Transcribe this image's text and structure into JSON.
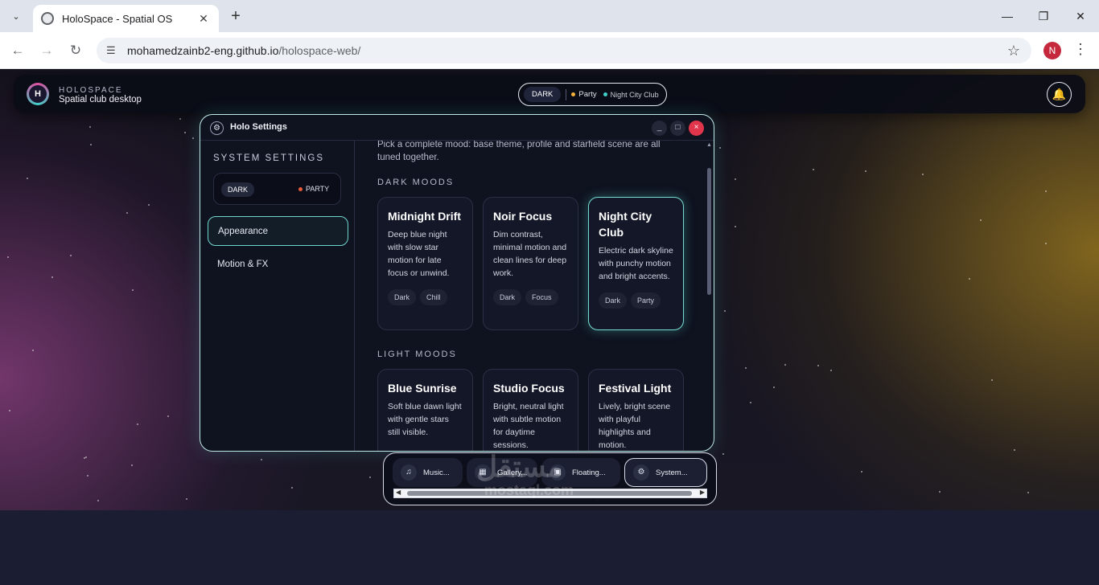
{
  "browser": {
    "tab_title": "HoloSpace - Spatial OS",
    "url_host": "mohamedzainb2-eng.github.io",
    "url_path": "/holospace-web/",
    "profile_initial": "N"
  },
  "header": {
    "logo_letter": "H",
    "brand_small": "HOLOSPACE",
    "brand_sub": "Spatial club desktop",
    "mode": "DARK",
    "profile_label": "Party",
    "scene_label": "Night City Club",
    "colors": {
      "party_dot": "#f4b23a",
      "scene_dot": "#3fd0c8"
    }
  },
  "settings_window": {
    "title": "Holo Settings",
    "sidebar": {
      "title": "SYSTEM SETTINGS",
      "toggle_dark": "DARK",
      "toggle_party": "PARTY",
      "items": [
        {
          "label": "Appearance",
          "active": true
        },
        {
          "label": "Motion & FX",
          "active": false
        }
      ]
    },
    "content": {
      "intro": "Pick a complete mood: base theme, profile and starfield scene are all tuned together.",
      "dark_heading": "DARK MOODS",
      "light_heading": "LIGHT MOODS",
      "dark_moods": [
        {
          "title": "Midnight Drift",
          "desc": "Deep blue night with slow star motion for late focus or unwind.",
          "tags": [
            "Dark",
            "Chill"
          ]
        },
        {
          "title": "Noir Focus",
          "desc": "Dim contrast, minimal motion and clean lines for deep work.",
          "tags": [
            "Dark",
            "Focus"
          ]
        },
        {
          "title": "Night City Club",
          "desc": "Electric dark skyline with punchy motion and bright accents.",
          "tags": [
            "Dark",
            "Party"
          ],
          "selected": true
        }
      ],
      "light_moods": [
        {
          "title": "Blue Sunrise",
          "desc": "Soft blue dawn light with gentle stars still visible."
        },
        {
          "title": "Studio Focus",
          "desc": "Bright, neutral light with subtle motion for daytime sessions."
        },
        {
          "title": "Festival Light",
          "desc": "Lively, bright scene with playful highlights and motion."
        }
      ]
    }
  },
  "dock": {
    "items": [
      {
        "label": "Music...",
        "icon": "headphones-icon"
      },
      {
        "label": "Gallery...",
        "icon": "image-icon"
      },
      {
        "label": "Floating...",
        "icon": "note-icon"
      },
      {
        "label": "System...",
        "icon": "gear-icon",
        "active": true
      }
    ]
  },
  "watermark": {
    "text": "مستقل",
    "sub": "mostaql.com"
  }
}
